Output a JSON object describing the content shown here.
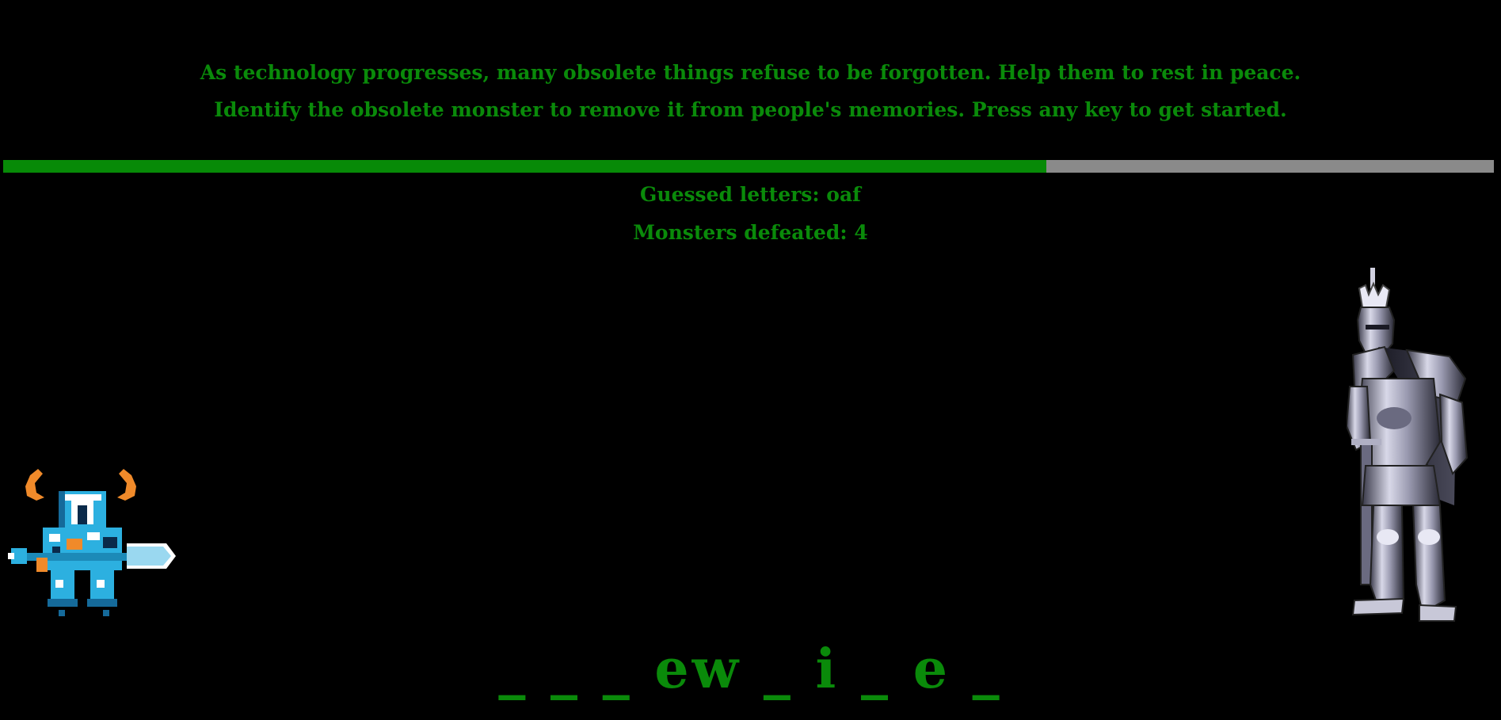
{
  "intro": {
    "line1": "As technology progresses, many obsolete things refuse to be forgotten. Help them to rest in peace.",
    "line2": "Identify the obsolete monster to remove it from people's memories. Press any key to get started."
  },
  "health": {
    "fraction": 0.7,
    "fill_color": "#078a07",
    "track_color": "#8a8a8a"
  },
  "stats": {
    "guessed": "Guessed letters: oaf",
    "defeated": "Monsters defeated: 4"
  },
  "word": {
    "display": "_ _ _ ew _ i _ e _"
  },
  "sprites": {
    "player": "horned-blue-knight-with-sword",
    "monster": "armored-knight-statue"
  },
  "colors": {
    "text": "#0a8a0a",
    "background": "#000000"
  }
}
